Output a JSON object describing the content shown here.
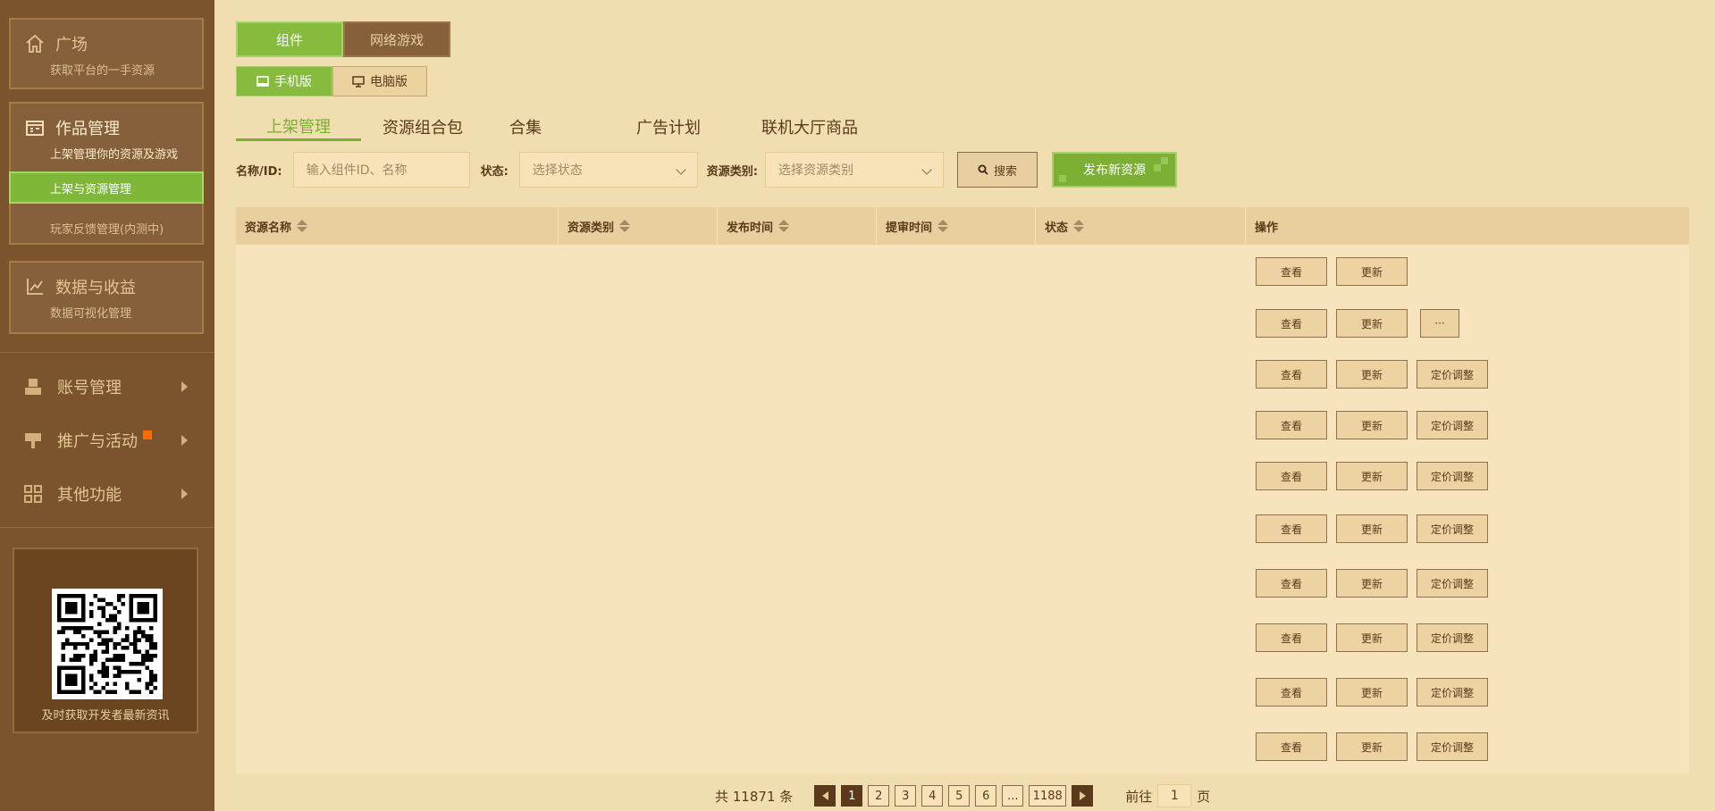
{
  "sidebar": {
    "square": {
      "title": "广场",
      "subtitle": "获取平台的一手资源",
      "icon": "home-icon"
    },
    "works": {
      "title": "作品管理",
      "subtitle": "上架管理你的资源及游戏",
      "icon": "folder-icon",
      "items": [
        {
          "label": "上架与资源管理"
        },
        {
          "label": "玩家反馈管理(内测中)"
        }
      ]
    },
    "data": {
      "title": "数据与收益",
      "subtitle": "数据可视化管理",
      "icon": "chart-icon"
    },
    "menu": [
      {
        "label": "账号管理",
        "icon": "account-icon"
      },
      {
        "label": "推广与活动",
        "icon": "promotion-icon"
      },
      {
        "label": "其他功能",
        "icon": "grid-icon"
      }
    ],
    "qr_caption": "及时获取开发者最新资讯"
  },
  "type_tabs": [
    {
      "label": "组件"
    },
    {
      "label": "网络游戏"
    }
  ],
  "platform_tabs": [
    {
      "label": "手机版"
    },
    {
      "label": "电脑版"
    }
  ],
  "sub_tabs": [
    {
      "label": "上架管理"
    },
    {
      "label": "资源组合包"
    },
    {
      "label": "合集"
    },
    {
      "label": "广告计划"
    },
    {
      "label": "联机大厅商品"
    }
  ],
  "filter": {
    "name_label": "名称/ID:",
    "name_placeholder": "输入组件ID、名称",
    "status_label": "状态:",
    "status_placeholder": "选择状态",
    "type_label": "资源类别:",
    "type_placeholder": "选择资源类别",
    "search_label": "搜索",
    "publish_label": "发布新资源"
  },
  "table": {
    "columns": [
      "资源名称",
      "资源类别",
      "发布时间",
      "提审时间",
      "状态",
      "操作"
    ],
    "actions": {
      "view": "查看",
      "update": "更新",
      "price": "定价调整",
      "more": "···"
    },
    "row_count": 10
  },
  "pagination": {
    "total_text": "共 11871 条",
    "pages": [
      "1",
      "2",
      "3",
      "4",
      "5",
      "6",
      "...",
      "1188"
    ],
    "current": "1",
    "goto_prefix": "前往",
    "goto_value": "1",
    "goto_suffix": "页"
  },
  "colors": {
    "accent_green": "#7cb034",
    "sidebar_bg": "#7b532c",
    "page_bg": "#f0ddb0",
    "badge_orange": "#ff6a00"
  }
}
